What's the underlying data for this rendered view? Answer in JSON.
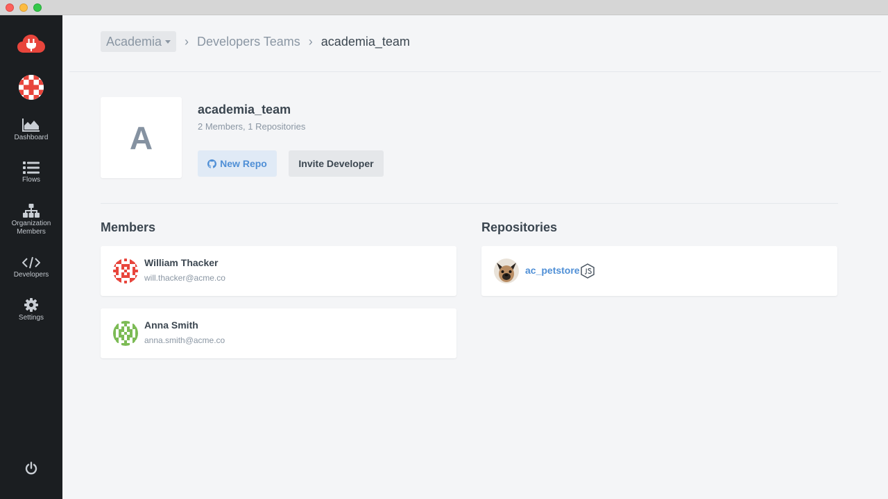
{
  "window": {
    "traffic_lights": [
      "close",
      "minimize",
      "maximize"
    ]
  },
  "colors": {
    "sidebar_bg": "#1b1e21",
    "accent": "#4f8fd6",
    "brand_red": "#e8453c",
    "content_bg": "#f4f5f7"
  },
  "sidebar": {
    "logo_icon": "cloud-plug-logo-icon",
    "org_avatar_icon": "identicon-red",
    "items": [
      {
        "label": "Dashboard",
        "icon": "area-chart-icon"
      },
      {
        "label": "Flows",
        "icon": "list-icon"
      },
      {
        "label": "Organization Members",
        "icon": "org-chart-icon"
      },
      {
        "label": "Developers",
        "icon": "code-icon"
      },
      {
        "label": "Settings",
        "icon": "gear-icon"
      }
    ],
    "power_icon": "power-icon"
  },
  "breadcrumb": {
    "org": "Academia",
    "section": "Developers Teams",
    "current": "academia_team"
  },
  "team": {
    "initial": "A",
    "name": "academia_team",
    "meta": "2 Members, 1 Repositories",
    "new_repo_label": "New Repo",
    "invite_label": "Invite Developer"
  },
  "members": {
    "title": "Members",
    "items": [
      {
        "name": "William Thacker",
        "email": "will.thacker@acme.co",
        "avatar": "identicon-red"
      },
      {
        "name": "Anna Smith",
        "email": "anna.smith@acme.co",
        "avatar": "identicon-green"
      }
    ]
  },
  "repositories": {
    "title": "Repositories",
    "items": [
      {
        "name": "ac_petstore",
        "avatar": "dog-photo",
        "tech_icon": "nodejs-icon"
      }
    ]
  }
}
